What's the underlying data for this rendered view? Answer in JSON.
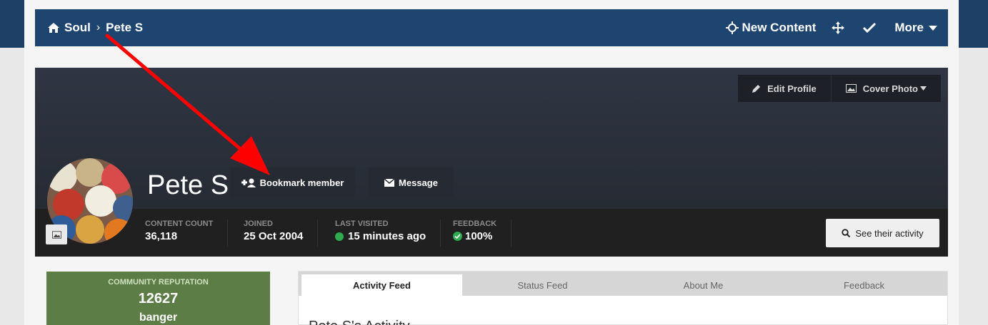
{
  "breadcrumb": {
    "home": "Soul",
    "current": "Pete S"
  },
  "nav": {
    "new_content": "New Content",
    "more": "More"
  },
  "cover": {
    "edit_profile": "Edit Profile",
    "cover_photo": "Cover Photo"
  },
  "profile": {
    "name": "Pete S",
    "bookmark": "Bookmark member",
    "message": "Message"
  },
  "stats": [
    {
      "label": "Content Count",
      "value": "36,118"
    },
    {
      "label": "Joined",
      "value": "25 Oct 2004"
    },
    {
      "label": "Last Visited",
      "value": "15 minutes ago"
    },
    {
      "label": "Feedback",
      "value": "100%"
    }
  ],
  "see_activity": "See their activity",
  "reputation": {
    "label": "COMMUNITY REPUTATION",
    "value": "12627",
    "title": "banger"
  },
  "tabs": [
    "Activity Feed",
    "Status Feed",
    "About Me",
    "Feedback"
  ],
  "feed_title": "Pete S's Activity",
  "colors": {
    "nav": "#1e4470",
    "reputation": "#5c7d45",
    "online": "#2eaa4f",
    "arrow": "#ff0000"
  }
}
